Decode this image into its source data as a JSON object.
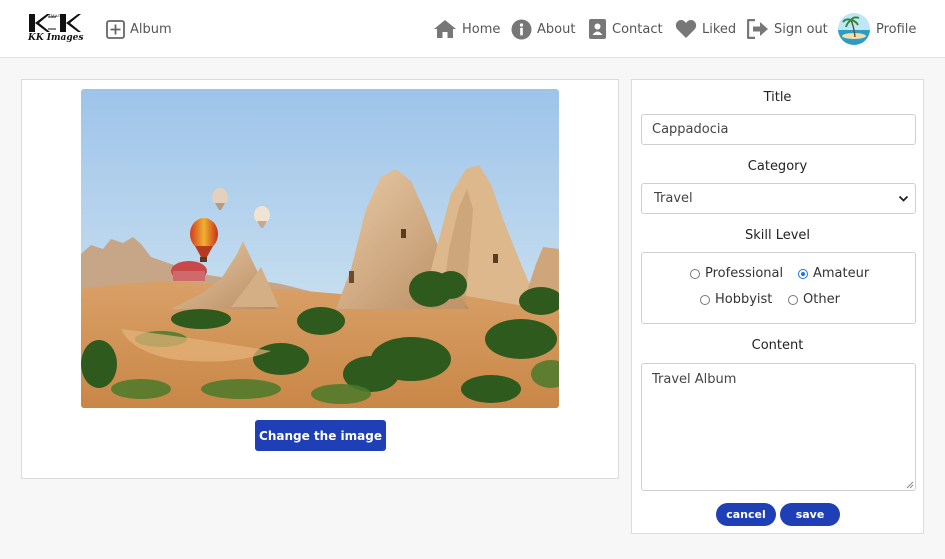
{
  "header": {
    "logo_brand": "KK Images",
    "logo_small": "IMAGES",
    "album_label": "Album",
    "nav": {
      "home": "Home",
      "about": "About",
      "contact": "Contact",
      "liked": "Liked",
      "signout": "Sign out",
      "profile": "Profile"
    }
  },
  "image_panel": {
    "change_button": "Change the image"
  },
  "form": {
    "title_label": "Title",
    "title_value": "Cappadocia",
    "category_label": "Category",
    "category_value": "Travel",
    "skill_label": "Skill Level",
    "skill_options": [
      "Professional",
      "Amateur",
      "Hobbyist",
      "Other"
    ],
    "skill_selected": "Amateur",
    "content_label": "Content",
    "content_value": "Travel Album",
    "cancel_label": "cancel",
    "save_label": "save"
  },
  "colors": {
    "primary_button": "#1f3fb6",
    "radio_accent": "#1a73e8",
    "nav_icon": "#777777"
  },
  "icons": [
    "plus-square-icon",
    "home-icon",
    "info-icon",
    "contact-book-icon",
    "heart-icon",
    "sign-out-icon",
    "chevron-down-icon",
    "resize-grip-icon"
  ]
}
